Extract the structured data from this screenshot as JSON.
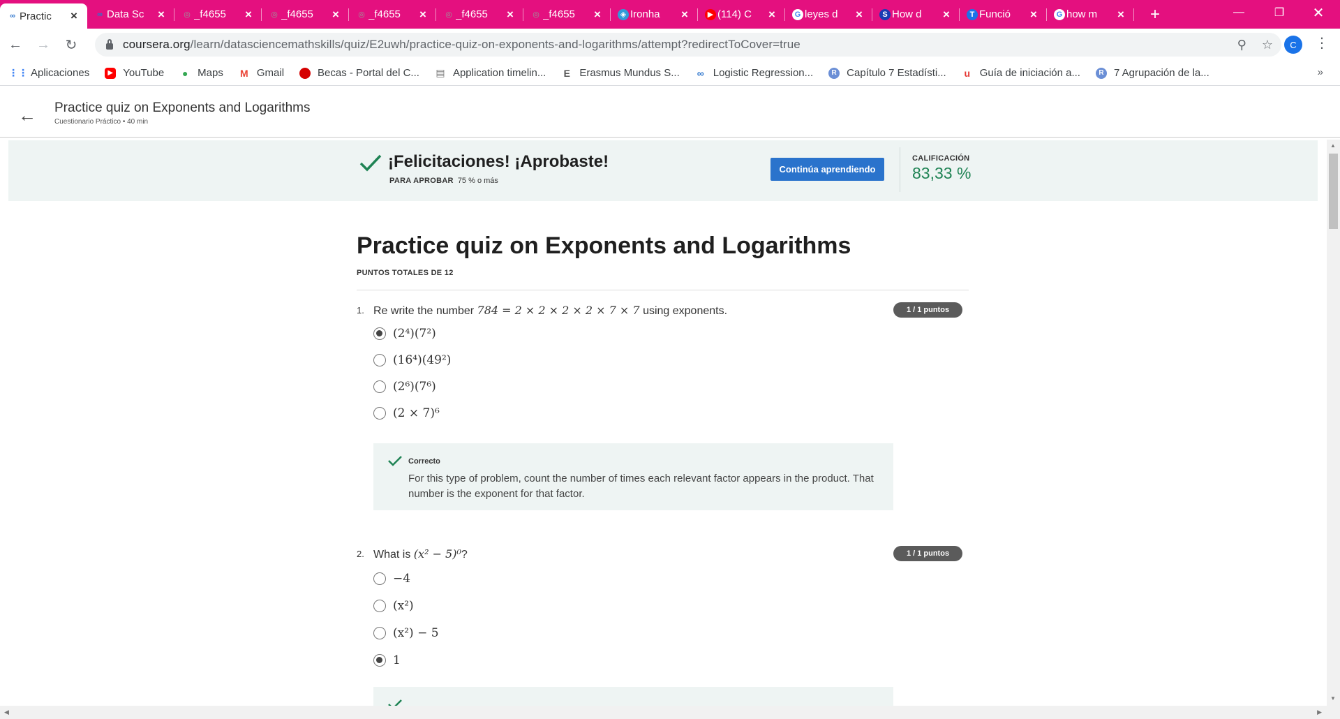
{
  "browser": {
    "tabs": [
      {
        "title": "Practic",
        "icon": "coursera-icon",
        "active": true
      },
      {
        "title": "Data Sc",
        "icon": "coursera-icon",
        "active": false
      },
      {
        "title": "_f4655",
        "icon": "globe-icon",
        "active": false
      },
      {
        "title": "_f4655",
        "icon": "globe-icon",
        "active": false
      },
      {
        "title": "_f4655",
        "icon": "globe-icon",
        "active": false
      },
      {
        "title": "_f4655",
        "icon": "globe-icon",
        "active": false
      },
      {
        "title": "_f4655",
        "icon": "globe-icon",
        "active": false
      },
      {
        "title": "Ironha",
        "icon": "ironhack-icon",
        "active": false
      },
      {
        "title": "(114) C",
        "icon": "youtube-icon",
        "active": false
      },
      {
        "title": "leyes d",
        "icon": "google-icon",
        "active": false
      },
      {
        "title": "How d",
        "icon": "s-icon",
        "active": false
      },
      {
        "title": "Funció",
        "icon": "t-icon",
        "active": false
      },
      {
        "title": "how m",
        "icon": "google-icon",
        "active": false
      }
    ],
    "url_host": "coursera.org",
    "url_path": "/learn/datasciencemathskills/quiz/E2uwh/practice-quiz-on-exponents-and-logarithms/attempt?redirectToCover=true",
    "profile_initial": "C",
    "bookmarks": [
      {
        "label": "Aplicaciones",
        "icon": "apps-grid-icon",
        "color": "#4285f4"
      },
      {
        "label": "YouTube",
        "icon": "youtube-icon",
        "color": "#ff0000"
      },
      {
        "label": "Maps",
        "icon": "maps-pin-icon",
        "color": "#34a853"
      },
      {
        "label": "Gmail",
        "icon": "gmail-icon",
        "color": "#ea4335"
      },
      {
        "label": "Becas - Portal del C...",
        "icon": "becas-icon",
        "color": "#d50000"
      },
      {
        "label": "Application timelin...",
        "icon": "application-icon",
        "color": "#7a7a7a"
      },
      {
        "label": "Erasmus Mundus S...",
        "icon": "erasmus-icon",
        "color": "#555555"
      },
      {
        "label": "Logistic Regression...",
        "icon": "coursera-icon",
        "color": "#2a73cc"
      },
      {
        "label": "Capítulo 7 Estadísti...",
        "icon": "r-icon",
        "color": "#6b8fd6"
      },
      {
        "label": "Guía de iniciación a...",
        "icon": "u-icon",
        "color": "#e53935"
      },
      {
        "label": "7 Agrupación de la...",
        "icon": "r-icon",
        "color": "#6b8fd6"
      }
    ],
    "bookmarks_more": "»"
  },
  "header": {
    "title": "Practice quiz on Exponents and Logarithms",
    "subtitle": "Cuestionario Práctico • 40 min"
  },
  "banner": {
    "title": "¡Felicitaciones! ¡Aprobaste!",
    "pass_label": "PARA APROBAR",
    "pass_value": "75 % o más",
    "button_label": "Continúa aprendiendo",
    "grade_label": "CALIFICACIÓN",
    "grade_value": "83,33 %",
    "accent_color": "#1f8354"
  },
  "quiz": {
    "title": "Practice quiz on Exponents and Logarithms",
    "total_points": "PUNTOS TOTALES DE 12",
    "questions": [
      {
        "number": "1.",
        "text_prefix": "Re write the number",
        "text_math": "784 = 2 × 2 × 2 × 2 × 7 × 7",
        "text_suffix": "using exponents.",
        "points": "1 / 1 puntos",
        "options": [
          "(2⁴)(7²)",
          "(16⁴)(49²)",
          "(2⁶)(7⁶)",
          "(2 × 7)⁶"
        ],
        "selected_index": 0,
        "feedback_title": "Correcto",
        "feedback_text": "For this type of problem, count the number of times each relevant factor appears in the product. That number is the exponent for that factor."
      },
      {
        "number": "2.",
        "text_prefix": "What is",
        "text_math": "(x² − 5)⁰",
        "text_suffix": "?",
        "points": "1 / 1 puntos",
        "options": [
          "−4",
          "(x²)",
          "(x²) − 5",
          "1"
        ],
        "selected_index": 3
      }
    ]
  }
}
